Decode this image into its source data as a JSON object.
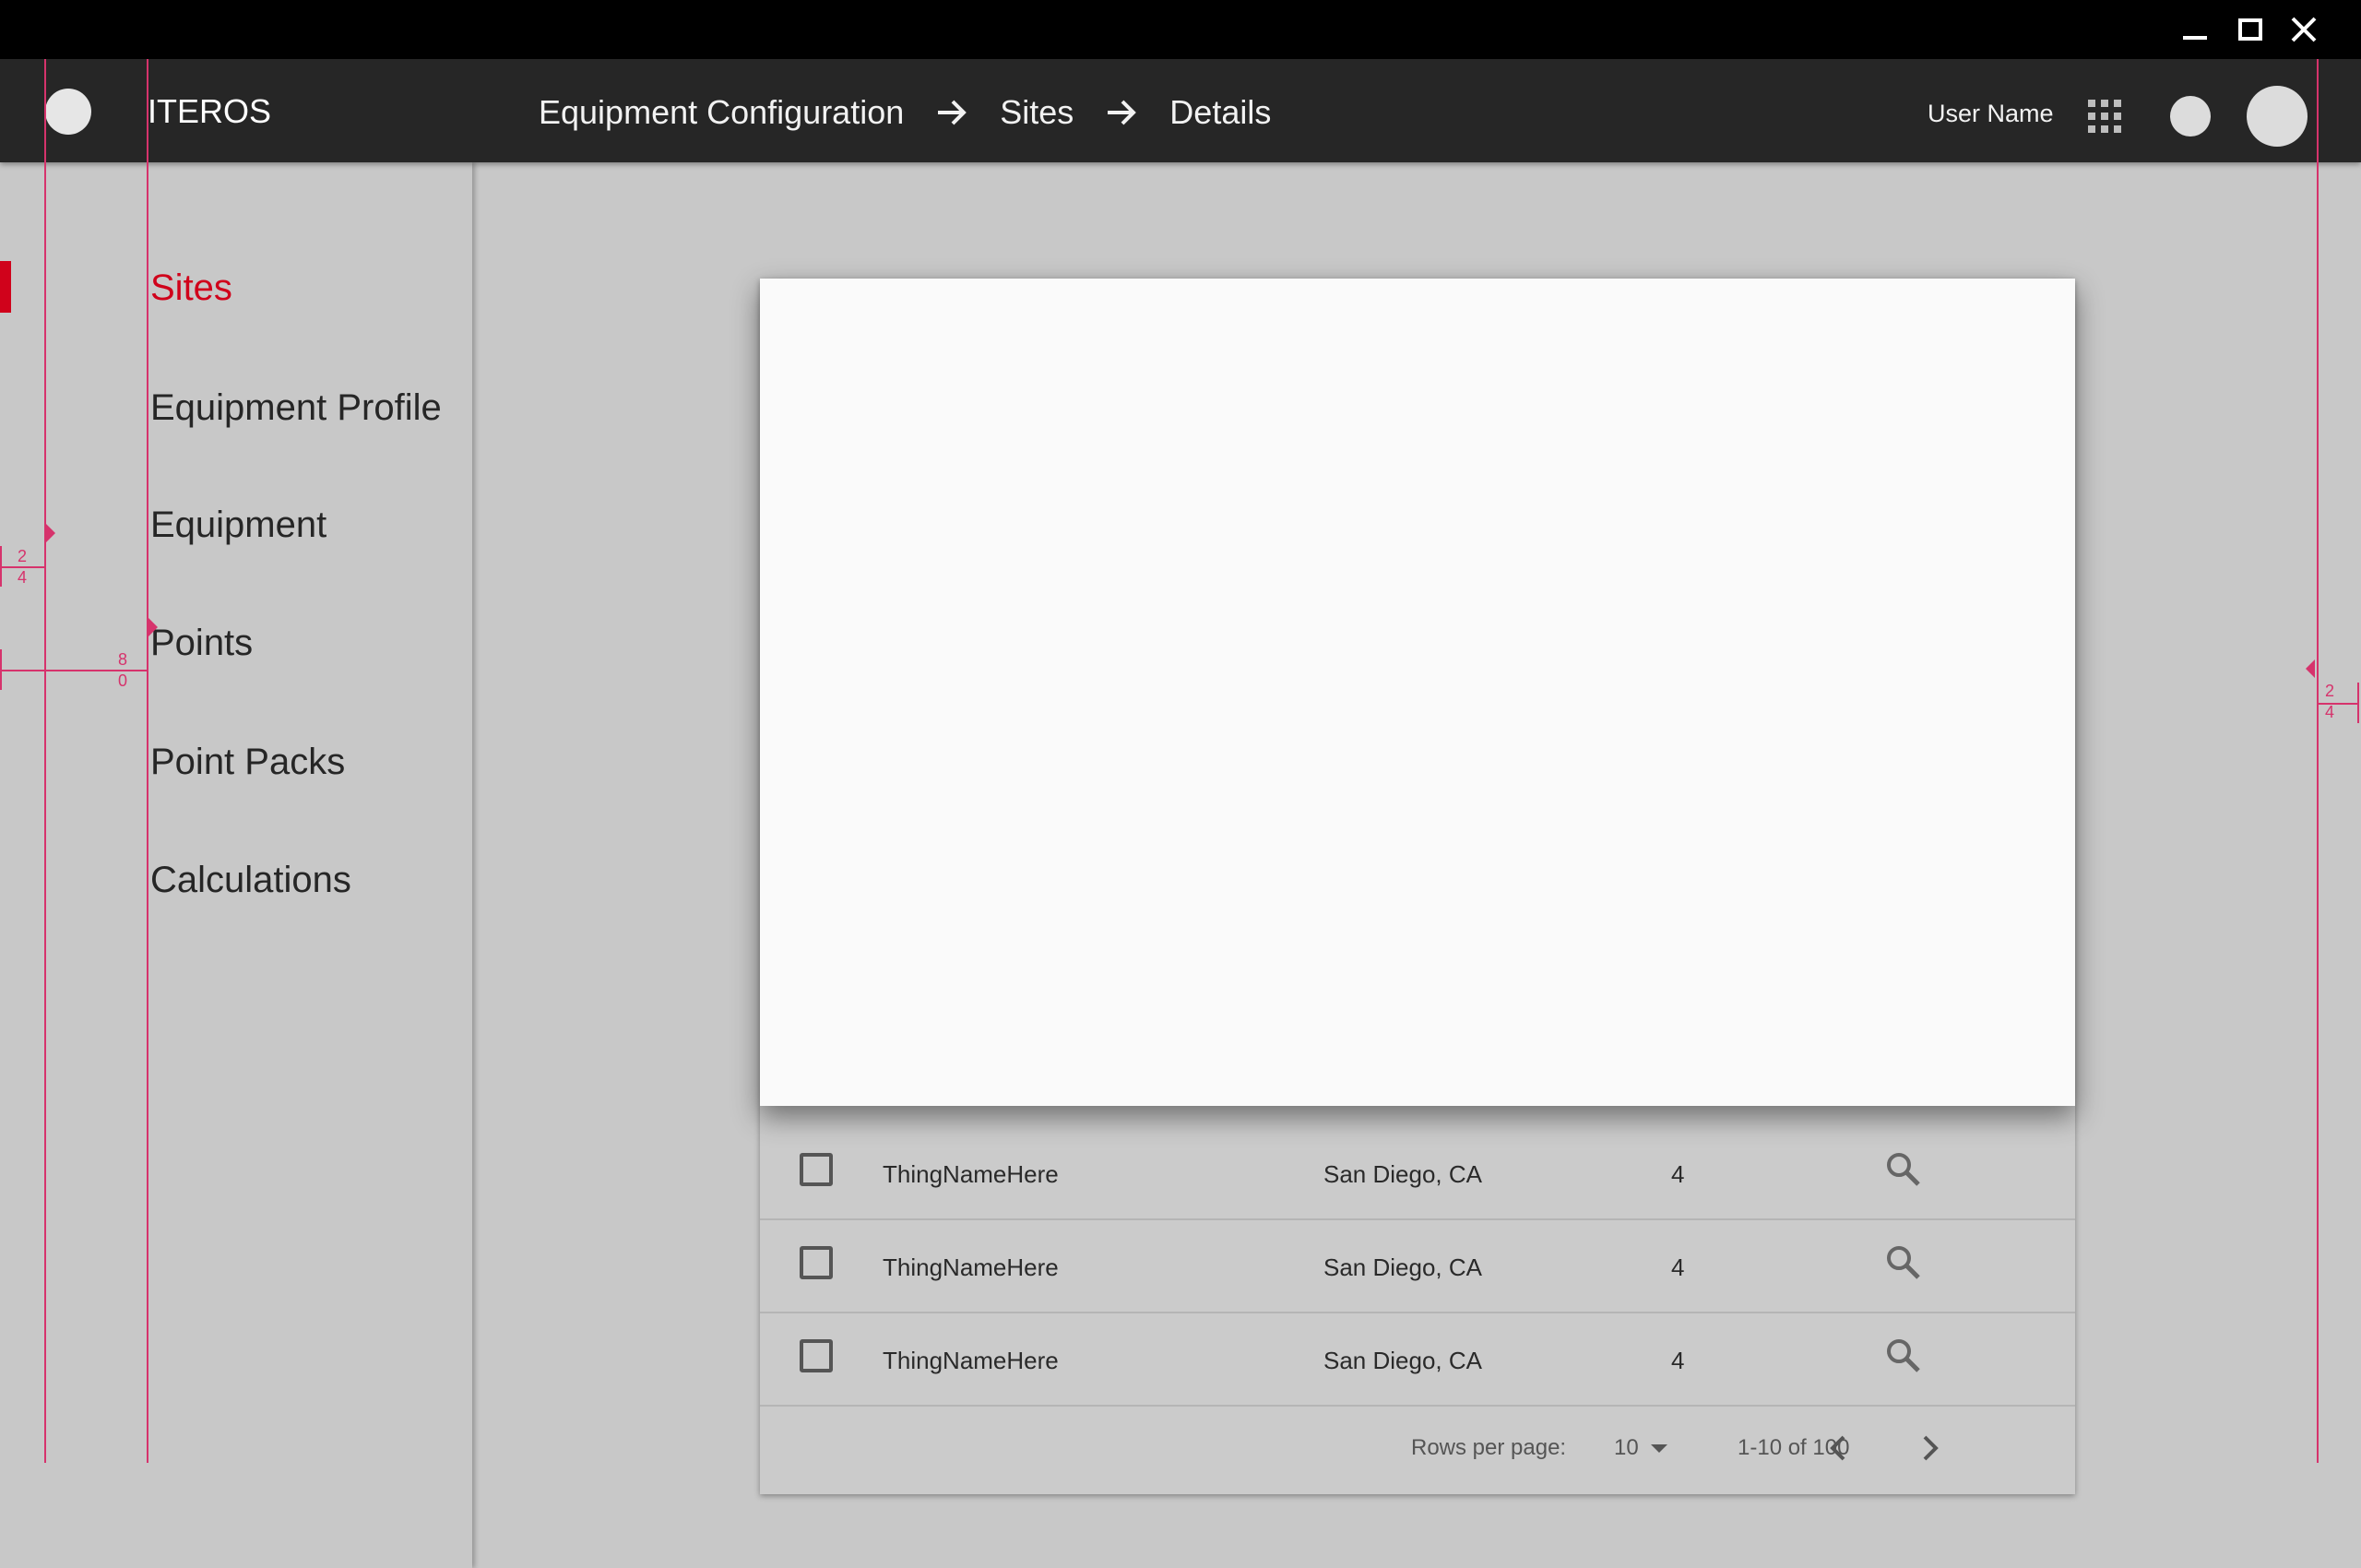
{
  "window": {
    "controls": [
      "minimize-icon",
      "maximize-icon",
      "close-icon"
    ]
  },
  "header": {
    "app_name": "ITEROS",
    "breadcrumb": [
      "Equipment Configuration",
      "Sites",
      "Details"
    ],
    "user_name": "User Name",
    "icons": [
      "logo-icon",
      "arrow-right-icon",
      "apps-grid-icon",
      "notification-icon",
      "avatar"
    ]
  },
  "sidebar": {
    "items": [
      {
        "label": "Sites",
        "active": true
      },
      {
        "label": "Equipment Profile",
        "active": false
      },
      {
        "label": "Equipment",
        "active": false
      },
      {
        "label": "Points",
        "active": false
      },
      {
        "label": "Point Packs",
        "active": false
      },
      {
        "label": "Calculations",
        "active": false
      }
    ],
    "active_color": "#d0021b"
  },
  "guides": {
    "left_margin": [
      "2",
      "4"
    ],
    "sidebar_indent": [
      "8",
      "0"
    ],
    "right_margin": [
      "2",
      "4"
    ],
    "color": "#d6336c"
  },
  "table": {
    "rows": [
      {
        "name": "ThingNameHere",
        "location": "San Diego, CA",
        "count": "4"
      },
      {
        "name": "ThingNameHere",
        "location": "San Diego, CA",
        "count": "4"
      },
      {
        "name": "ThingNameHere",
        "location": "San Diego, CA",
        "count": "4"
      }
    ],
    "footer": {
      "rows_per_page_label": "Rows per page:",
      "rows_per_page_value": "10",
      "range": "1-10 of 100"
    }
  }
}
